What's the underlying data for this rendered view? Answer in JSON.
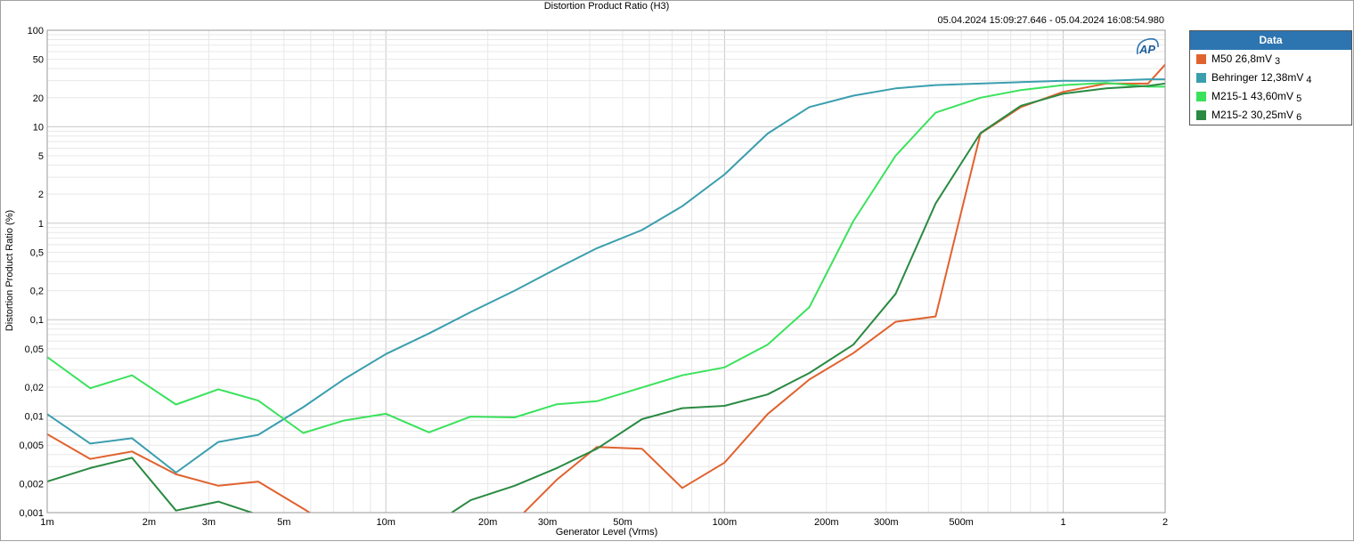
{
  "chart_data": {
    "type": "line",
    "title": "Distortion Product Ratio (H3)",
    "subtitle": "05.04.2024 15:09:27.646 - 05.04.2024 16:08:54.980",
    "xlabel": "Generator Level (Vrms)",
    "ylabel": "Distortion Product Ratio (%)",
    "x_scale": "log",
    "y_scale": "log",
    "xlim": [
      0.001,
      2
    ],
    "ylim": [
      0.001,
      100
    ],
    "grid": true,
    "legend_position": "right",
    "legend_title": "Data",
    "x_ticks": [
      {
        "value": 0.001,
        "label": "1m"
      },
      {
        "value": 0.002,
        "label": "2m"
      },
      {
        "value": 0.003,
        "label": "3m"
      },
      {
        "value": 0.005,
        "label": "5m"
      },
      {
        "value": 0.01,
        "label": "10m"
      },
      {
        "value": 0.02,
        "label": "20m"
      },
      {
        "value": 0.03,
        "label": "30m"
      },
      {
        "value": 0.05,
        "label": "50m"
      },
      {
        "value": 0.1,
        "label": "100m"
      },
      {
        "value": 0.2,
        "label": "200m"
      },
      {
        "value": 0.3,
        "label": "300m"
      },
      {
        "value": 0.5,
        "label": "500m"
      },
      {
        "value": 1,
        "label": "1"
      },
      {
        "value": 2,
        "label": "2"
      }
    ],
    "y_ticks": [
      {
        "value": 100,
        "label": "100"
      },
      {
        "value": 50,
        "label": "50"
      },
      {
        "value": 20,
        "label": "20"
      },
      {
        "value": 10,
        "label": "10"
      },
      {
        "value": 5,
        "label": "5"
      },
      {
        "value": 2,
        "label": "2"
      },
      {
        "value": 1,
        "label": "1"
      },
      {
        "value": 0.5,
        "label": "0,5"
      },
      {
        "value": 0.2,
        "label": "0,2"
      },
      {
        "value": 0.1,
        "label": "0,1"
      },
      {
        "value": 0.05,
        "label": "0,05"
      },
      {
        "value": 0.02,
        "label": "0,02"
      },
      {
        "value": 0.01,
        "label": "0,01"
      },
      {
        "value": 0.005,
        "label": "0,005"
      },
      {
        "value": 0.002,
        "label": "0,002"
      },
      {
        "value": 0.001,
        "label": "0,001"
      }
    ],
    "x": [
      0.001,
      0.00134,
      0.00178,
      0.0024,
      0.0032,
      0.0042,
      0.0057,
      0.0075,
      0.01,
      0.0134,
      0.0178,
      0.024,
      0.032,
      0.042,
      0.057,
      0.075,
      0.1,
      0.134,
      0.178,
      0.24,
      0.32,
      0.42,
      0.57,
      0.75,
      1,
      1.34,
      1.78,
      2
    ],
    "series": [
      {
        "name": "M50",
        "legend_value": "26,8mV",
        "index": "3",
        "color": "#e0622e",
        "values": [
          0.0065,
          0.0036,
          0.0043,
          0.0025,
          0.0019,
          0.0021,
          0.0011,
          0.0006,
          0.0009,
          0.0005,
          0.0006,
          0.0008,
          0.0022,
          0.0048,
          0.0046,
          0.0018,
          0.0033,
          0.0105,
          0.024,
          0.045,
          0.095,
          0.108,
          8.5,
          16,
          23,
          28,
          28,
          44
        ]
      },
      {
        "name": "Behringer",
        "legend_value": "12,38mV",
        "index": "4",
        "color": "#3a9eae",
        "values": [
          0.0105,
          0.0052,
          0.0059,
          0.0026,
          0.0054,
          0.0064,
          0.0124,
          0.024,
          0.044,
          0.072,
          0.12,
          0.2,
          0.34,
          0.55,
          0.85,
          1.5,
          3.2,
          8.5,
          16,
          21,
          25,
          27,
          28,
          29,
          30,
          30,
          31,
          31
        ]
      },
      {
        "name": "M215-1",
        "legend_value": "43,60mV",
        "index": "5",
        "color": "#3ae25c",
        "values": [
          0.041,
          0.0195,
          0.0265,
          0.0132,
          0.019,
          0.0145,
          0.0067,
          0.009,
          0.0106,
          0.0068,
          0.0099,
          0.0097,
          0.0133,
          0.0143,
          0.0198,
          0.0265,
          0.032,
          0.055,
          0.135,
          1.05,
          5,
          14,
          20,
          24,
          27,
          28.5,
          26,
          26
        ]
      },
      {
        "name": "M215-2",
        "legend_value": "30,25mV",
        "index": "6",
        "color": "#2a8a42",
        "values": [
          0.0021,
          0.0029,
          0.0037,
          0.00105,
          0.0013,
          0.00095,
          0.0006,
          0.0005,
          0.0005,
          0.0007,
          0.00135,
          0.0019,
          0.0029,
          0.0046,
          0.0093,
          0.0121,
          0.0128,
          0.0168,
          0.028,
          0.055,
          0.185,
          1.6,
          8.6,
          16.5,
          22,
          25,
          26.5,
          28
        ]
      }
    ]
  },
  "window": {
    "title": "Distortion Product Ratio (H3)",
    "timestamp": "05.04.2024 15:09:27.646 - 05.04.2024 16:08:54.980"
  },
  "legend": {
    "title": "Data"
  },
  "logo": {
    "text": "AP"
  }
}
